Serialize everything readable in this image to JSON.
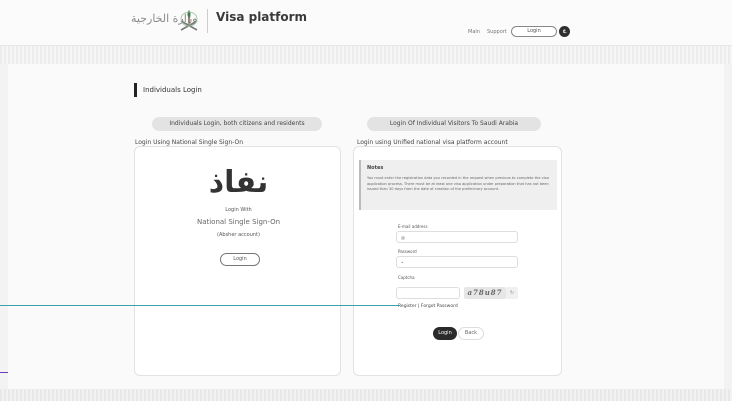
{
  "header": {
    "logo_text": "وزارة الخارجية",
    "platform_title": "Visa platform",
    "nav": {
      "home": "Main",
      "support": "Support"
    },
    "login_button": "Login",
    "lang_badge": "ع"
  },
  "page": {
    "heading": "Individuals Login",
    "section_left": "Individuals Login, both citizens and residents",
    "section_right": "Login Of Individual Visitors To Saudi Arabia",
    "caption_left": "Login Using National Single Sign-On",
    "caption_right": "Login using Unified national visa platform account"
  },
  "nafath": {
    "logo": "نفاذ",
    "login_with": "Login With",
    "service": "National Single Sign-On",
    "absher": "(Absher account)",
    "login_button": "Login"
  },
  "account_login": {
    "notes_title": "Notes",
    "notes_text": "You must enter the registration data you recorded in the request when previous to complete the visa application process. There must be at least one visa application under preparation that has not been issued than 30 days from the date of creation of the preliminary account.",
    "email_label": "E-mail address",
    "email_placeholder": "@",
    "password_label": "Password",
    "password_placeholder": "•",
    "captcha_label": "Captcha",
    "captcha_text": "a78u87",
    "register": "Register",
    "separator": " | ",
    "forgot": "Forgot Password",
    "login_button": "Login",
    "back_button": "Back"
  },
  "colors": {
    "pointer_line": "#3aa1a9",
    "accent_tick": "#6a3cb8",
    "primary_button": "#2a2a2a"
  }
}
